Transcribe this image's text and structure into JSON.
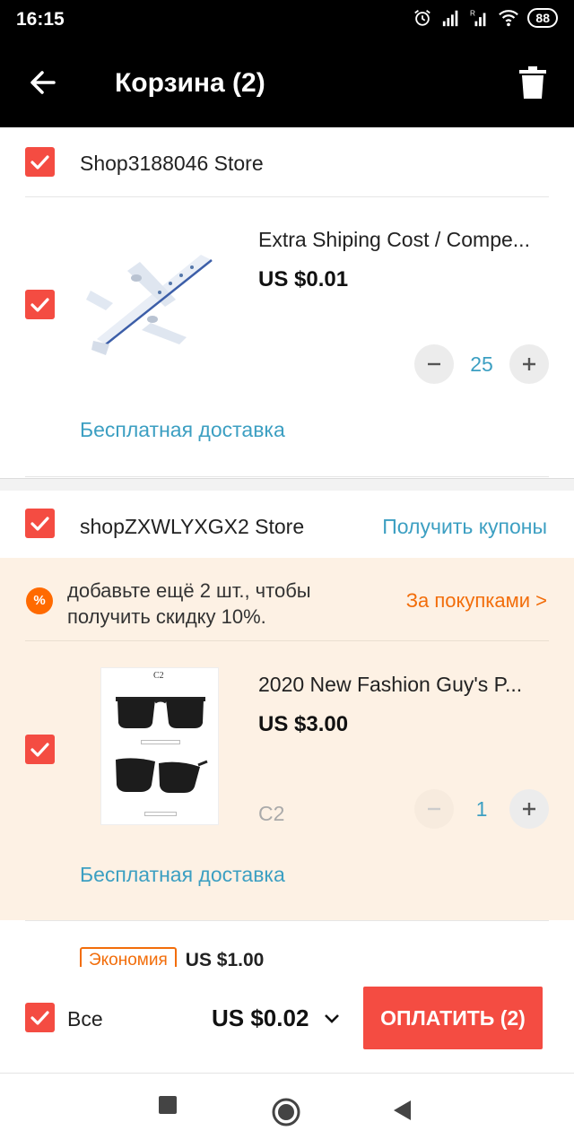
{
  "status_bar": {
    "time": "16:15",
    "battery": "88",
    "icons": [
      "alarm-icon",
      "signal-icon",
      "signal-roaming-icon",
      "wifi-icon",
      "battery-icon"
    ]
  },
  "header": {
    "title": "Корзина (2)",
    "back_icon": "arrow-left-icon",
    "delete_icon": "trash-icon"
  },
  "stores": [
    {
      "name": "Shop3188046 Store",
      "checked": true,
      "items": [
        {
          "title": "Extra Shiping Cost / Compe...",
          "price": "US $0.01",
          "quantity": "25",
          "shipping": "Бесплатная доставка",
          "checked": true
        }
      ]
    },
    {
      "name": "shopZXWLYXGX2 Store",
      "checked": true,
      "coupon_link": "Получить купоны",
      "promo": {
        "icon_text": "%",
        "text": "добавьте ещё 2 шт., чтобы получить скидку 10%.",
        "link": "За покупками >"
      },
      "items": [
        {
          "title": "2020 New Fashion Guy's  P...",
          "price": "US $3.00",
          "variant": "C2",
          "quantity": "1",
          "shipping": "Бесплатная доставка",
          "checked": true,
          "image_label": "C2"
        }
      ],
      "savings": {
        "badge": "Экономия",
        "amount": "US $1.00"
      }
    }
  ],
  "bottom_bar": {
    "select_all_label": "Все",
    "total": "US $0.02",
    "pay_button": "ОПЛАТИТЬ (2)"
  },
  "nav_bar": {
    "icons": [
      "recents-square-icon",
      "home-circle-icon",
      "back-triangle-icon"
    ]
  },
  "colors": {
    "accent_red": "#f44c42",
    "link_blue": "#3c9fc2",
    "promo_orange": "#f26d0a",
    "promo_bg": "#fdf1e4"
  }
}
